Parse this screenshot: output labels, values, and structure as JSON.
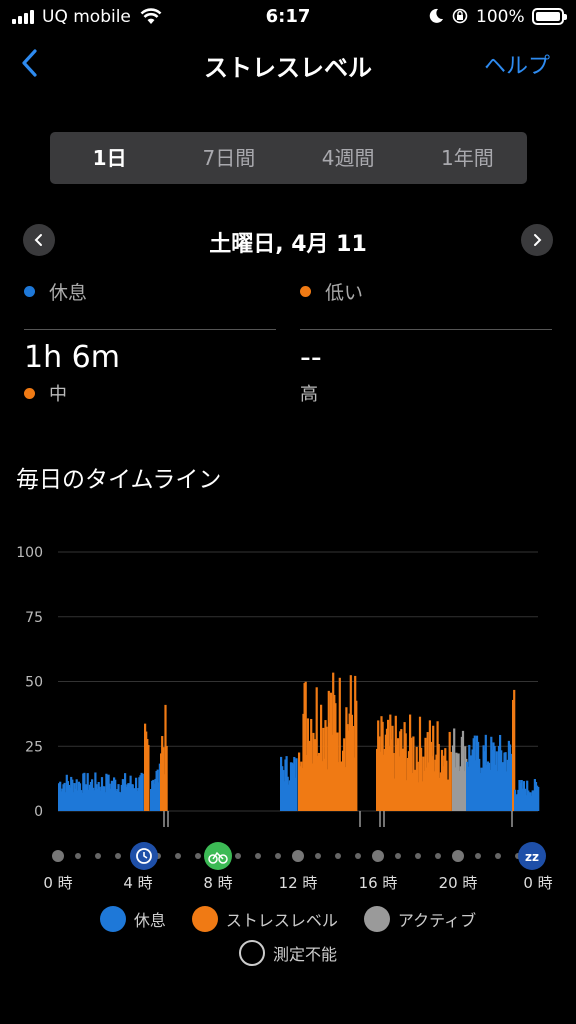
{
  "status_bar": {
    "carrier": "UQ mobile",
    "time": "6:17",
    "battery": "100%"
  },
  "nav": {
    "title": "ストレスレベル",
    "help": "ヘルプ"
  },
  "tabs": [
    {
      "label": "1日",
      "active": true
    },
    {
      "label": "7日間",
      "active": false
    },
    {
      "label": "4週間",
      "active": false
    },
    {
      "label": "1年間",
      "active": false
    }
  ],
  "date": {
    "label": "土曜日, 4月 11"
  },
  "summary": {
    "clipped_left_label": "休息",
    "clipped_right_label": "低い",
    "left": {
      "value": "1h 6m",
      "category": "中"
    },
    "right": {
      "value": "--",
      "category": "高"
    }
  },
  "section_title": "毎日のタイムライン",
  "colors": {
    "rest": "#1e78d8",
    "stress": "#f07a14",
    "active": "#9a9a9a",
    "accent": "#2e8bf0"
  },
  "chart_data": {
    "type": "bar",
    "ylim": [
      0,
      100
    ],
    "yticks": [
      "100",
      "75",
      "50",
      "25",
      "0"
    ],
    "xticks": [
      "0 時",
      "4 時",
      "8 時",
      "12 時",
      "16 時",
      "20 時",
      "0 時"
    ],
    "x_unit": "hours",
    "segments": [
      {
        "series": "休息",
        "start": 0.0,
        "end": 4.2,
        "level": 12
      },
      {
        "series": "ストレスレベル",
        "start": 4.3,
        "end": 4.5,
        "level": 30
      },
      {
        "series": "休息",
        "start": 4.6,
        "end": 5.1,
        "level": 15
      },
      {
        "series": "ストレスレベル",
        "start": 5.1,
        "end": 5.4,
        "level": 33
      },
      {
        "series": "休息",
        "start": 11.1,
        "end": 11.9,
        "level": 18
      },
      {
        "series": "ストレスレベル",
        "start": 12.0,
        "end": 14.9,
        "level": 45
      },
      {
        "series": "ストレスレベル",
        "start": 15.9,
        "end": 19.6,
        "level": 30
      },
      {
        "series": "アクティブ",
        "start": 19.7,
        "end": 20.4,
        "level": 27
      },
      {
        "series": "休息",
        "start": 20.4,
        "end": 22.6,
        "level": 24
      },
      {
        "series": "ストレスレベル",
        "start": 22.7,
        "end": 22.8,
        "level": 52
      },
      {
        "series": "休息",
        "start": 22.8,
        "end": 24.0,
        "level": 10
      }
    ],
    "timeline_icons": [
      {
        "hour": 4.3,
        "icon": "clock-icon"
      },
      {
        "hour": 8.0,
        "icon": "bike-icon"
      },
      {
        "hour": 23.7,
        "icon": "sleep-icon"
      }
    ]
  },
  "legend": [
    {
      "label": "休息",
      "color": "#1e78d8"
    },
    {
      "label": "ストレスレベル",
      "color": "#f07a14"
    },
    {
      "label": "アクティブ",
      "color": "#9a9a9a"
    }
  ],
  "legend_unmeasurable": "測定不能"
}
